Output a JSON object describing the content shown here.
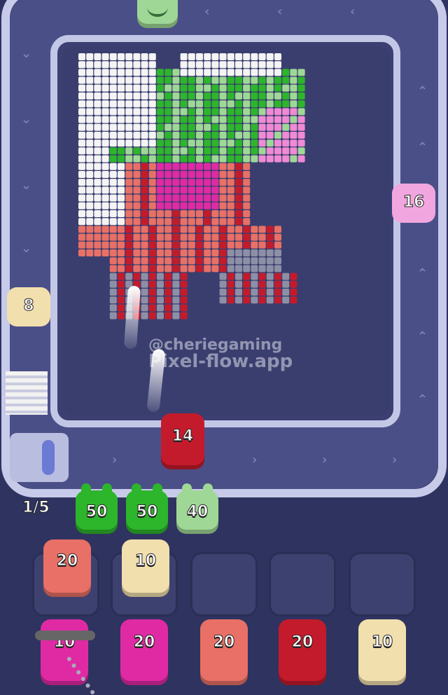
{
  "watermark": {
    "handle": "@cheriegaming",
    "site": "Pixel-flow.app"
  },
  "queue_counter": "1/5",
  "colors": {
    "background": "#2f3360",
    "board": "#3a3e6f",
    "track": "#c7cbe9",
    "white": "#f4f4f4",
    "green": "#2db52b",
    "light_green": "#9fd896",
    "pink": "#f08ad4",
    "magenta": "#e02aa4",
    "salmon": "#e87066",
    "red": "#c41b2c",
    "cream": "#f2dfae",
    "gray": "#8d8fa6"
  },
  "shooters": {
    "top": {
      "color": "light_green",
      "icon": "frog-face-icon"
    },
    "right": {
      "value": "16",
      "color": "pink"
    },
    "left": {
      "value": "8",
      "color": "cream"
    },
    "active": {
      "value": "14",
      "color": "red"
    }
  },
  "queue": [
    {
      "value": "50",
      "color": "green"
    },
    {
      "value": "50",
      "color": "green"
    },
    {
      "value": "40",
      "color": "light_green"
    }
  ],
  "slots": [
    {
      "value": "20",
      "color": "salmon"
    },
    {
      "value": "10",
      "color": "cream"
    },
    {
      "value": "",
      "color": ""
    },
    {
      "value": "",
      "color": ""
    },
    {
      "value": "",
      "color": ""
    }
  ],
  "bottom_row": [
    {
      "value": "10",
      "color": "magenta",
      "locked": true
    },
    {
      "value": "20",
      "color": "magenta",
      "locked": false
    },
    {
      "value": "20",
      "color": "salmon",
      "locked": false
    },
    {
      "value": "20",
      "color": "red",
      "locked": false
    },
    {
      "value": "10",
      "color": "cream",
      "locked": false
    }
  ]
}
